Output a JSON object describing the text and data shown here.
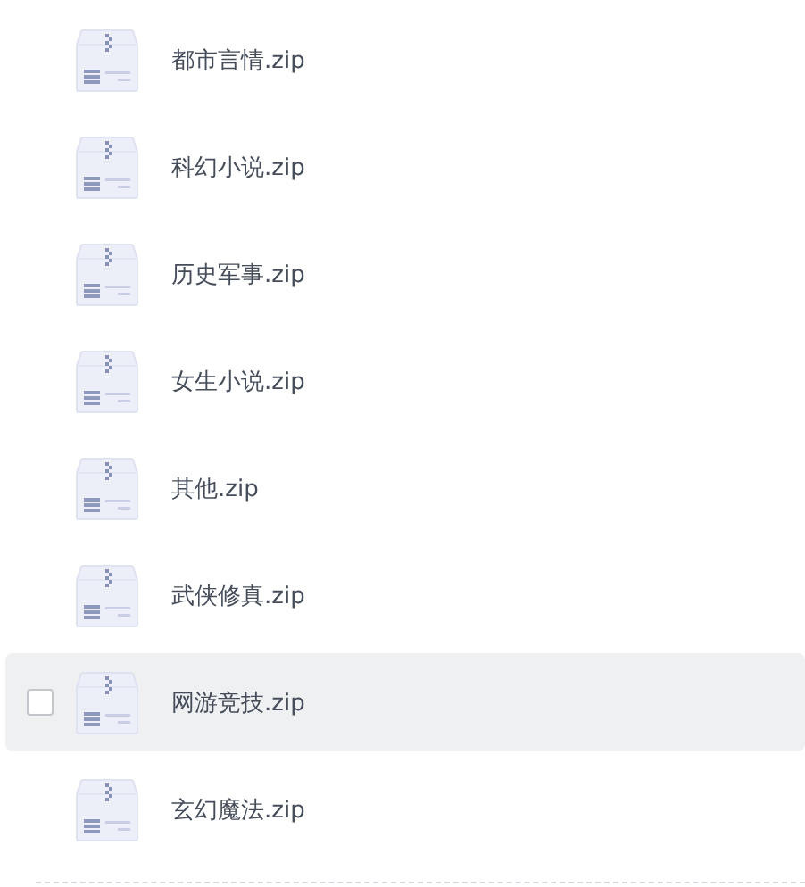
{
  "files": [
    {
      "name": "都市言情.zip",
      "hovered": false
    },
    {
      "name": "科幻小说.zip",
      "hovered": false
    },
    {
      "name": "历史军事.zip",
      "hovered": false
    },
    {
      "name": "女生小说.zip",
      "hovered": false
    },
    {
      "name": "其他.zip",
      "hovered": false
    },
    {
      "name": "武侠修真.zip",
      "hovered": false
    },
    {
      "name": "网游竞技.zip",
      "hovered": true,
      "checked": false
    },
    {
      "name": "玄幻魔法.zip",
      "hovered": false
    }
  ]
}
